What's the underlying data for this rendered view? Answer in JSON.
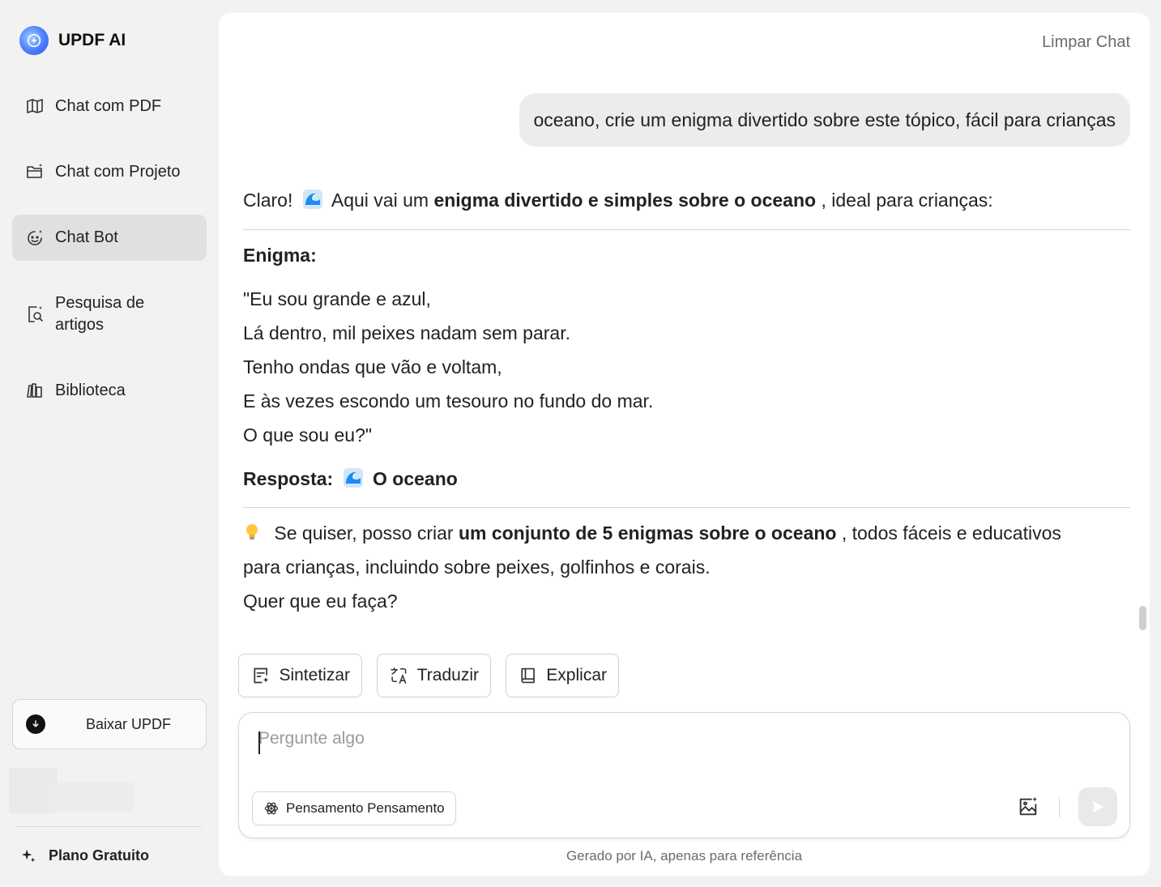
{
  "brand": {
    "name": "UPDF AI"
  },
  "sidebar": {
    "items": [
      {
        "label": "Chat com PDF"
      },
      {
        "label": "Chat com Projeto"
      },
      {
        "label": "Chat Bot"
      },
      {
        "label_line1": "Pesquisa de",
        "label_line2": "artigos"
      },
      {
        "label": "Biblioteca"
      }
    ],
    "download_label": "Baixar UPDF",
    "plan_label": "Plano Gratuito"
  },
  "header": {
    "clear_chat": "Limpar Chat"
  },
  "conversation": {
    "user_message": "oceano, crie um enigma divertido sobre este tópico, fácil para crianças",
    "answer": {
      "intro_start": "Claro!",
      "intro_mid": "Aqui vai um",
      "intro_bold": "enigma divertido e simples sobre o oceano",
      "intro_end": ", ideal para crianças:",
      "riddle_heading": "Enigma:",
      "riddle_lines": [
        "\"Eu sou grande e azul,",
        "Lá dentro, mil peixes nadam sem parar.",
        "Tenho ondas que vão e voltam,",
        "E às vezes escondo um tesouro no fundo do mar.",
        "O que sou eu?\""
      ],
      "answer_label": "Resposta:",
      "answer_value": "O oceano",
      "followup_start": "Se quiser, posso criar",
      "followup_bold": "um conjunto de 5 enigmas sobre o oceano",
      "followup_end": ", todos fáceis e educativos",
      "followup_line2": "para crianças, incluindo sobre peixes, golfinhos e corais.",
      "followup_line3": "Quer que eu faça?"
    }
  },
  "actions": {
    "summarize": "Sintetizar",
    "translate": "Traduzir",
    "explain": "Explicar"
  },
  "composer": {
    "placeholder": "Pergunte algo",
    "thinking_label": "Pensamento Pensamento"
  },
  "footer": {
    "note": "Gerado por IA, apenas para referência"
  },
  "colors": {
    "active_nav": "#e0e0e0",
    "panel": "#ffffff",
    "background": "#f2f2f2",
    "user_bubble": "#ececec"
  }
}
